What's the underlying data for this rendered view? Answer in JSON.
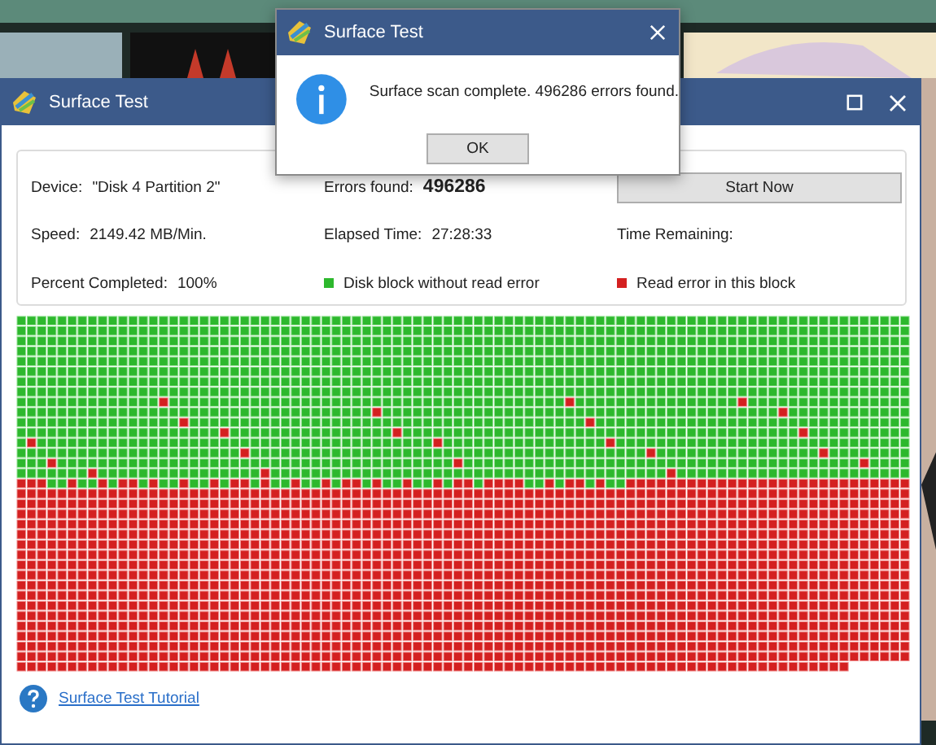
{
  "main_window": {
    "title": "Surface Test",
    "info": [
      {
        "kind": "field",
        "label": "Device:",
        "value": "\"Disk 4 Partition 2\""
      },
      {
        "kind": "count",
        "label": "Errors found:",
        "value": "496286"
      },
      {
        "kind": "button",
        "label": "Start Now"
      },
      {
        "kind": "field",
        "label": "Speed:",
        "value": "2149.42 MB/Min."
      },
      {
        "kind": "field",
        "label": "Elapsed Time:",
        "value": "27:28:33"
      },
      {
        "kind": "field",
        "label": "Time Remaining:"
      },
      {
        "kind": "field",
        "label": "Percent Completed:",
        "value": "100%"
      },
      {
        "kind": "legend",
        "label": "Disk block without read error",
        "color": "#2db82d"
      },
      {
        "kind": "legend",
        "label": "Read error in this block",
        "color": "#d42020"
      }
    ],
    "link": "Surface Test Tutorial"
  },
  "dialog": {
    "title": "Surface Test",
    "message": "Surface scan complete. 496286 errors found.",
    "button": "OK"
  }
}
